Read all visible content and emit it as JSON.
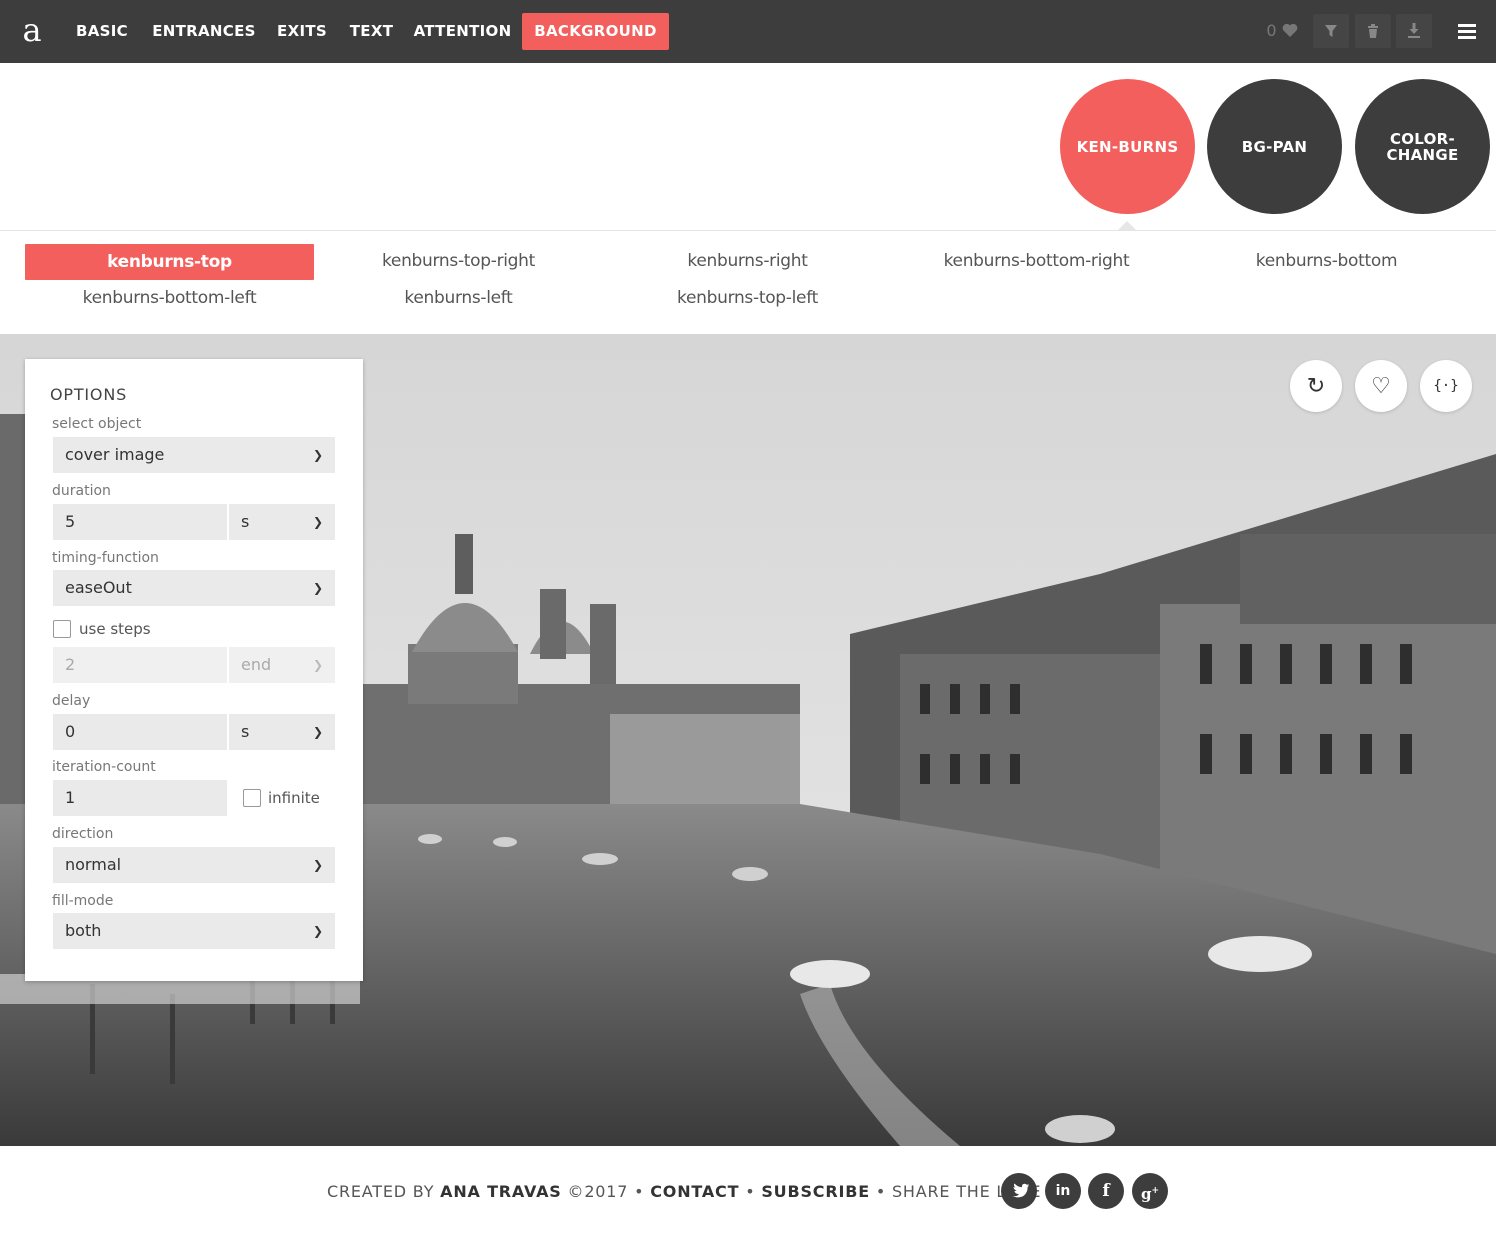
{
  "nav": {
    "logo": "a",
    "items": [
      "BASIC",
      "ENTRANCES",
      "EXITS",
      "TEXT",
      "ATTENTION",
      "BACKGROUND"
    ],
    "active_index": 5,
    "favorites_count": "0"
  },
  "categories": [
    {
      "label": "KEN-BURNS",
      "active": true
    },
    {
      "label": "BG-PAN",
      "active": false
    },
    {
      "label": "COLOR-\nCHANGE",
      "active": false
    }
  ],
  "animations": [
    "kenburns-top",
    "kenburns-top-right",
    "kenburns-right",
    "kenburns-bottom-right",
    "kenburns-bottom",
    "kenburns-bottom-left",
    "kenburns-left",
    "kenburns-top-left"
  ],
  "options": {
    "title": "OPTIONS",
    "select_object_label": "select object",
    "select_object_value": "cover image",
    "duration_label": "duration",
    "duration_value": "5",
    "duration_unit": "s",
    "timing_label": "timing-function",
    "timing_value": "easeOut",
    "use_steps_label": "use steps",
    "steps_value": "2",
    "steps_position": "end",
    "delay_label": "delay",
    "delay_value": "0",
    "delay_unit": "s",
    "iteration_label": "iteration-count",
    "iteration_value": "1",
    "infinite_label": "infinite",
    "direction_label": "direction",
    "direction_value": "normal",
    "fill_label": "fill-mode",
    "fill_value": "both"
  },
  "stage_buttons": {
    "replay": "↻",
    "favorite": "♡",
    "code": "{·}"
  },
  "footer": {
    "created_by": "CREATED BY",
    "author": "ANA TRAVAS",
    "year": "©2017",
    "bullet": "•",
    "contact": "CONTACT",
    "subscribe": "SUBSCRIBE",
    "share": "SHARE THE LOVE",
    "social": [
      "twitter",
      "linkedin",
      "facebook",
      "google-plus"
    ]
  },
  "colors": {
    "accent": "#f25f5c",
    "dark": "#3d3d3d"
  }
}
